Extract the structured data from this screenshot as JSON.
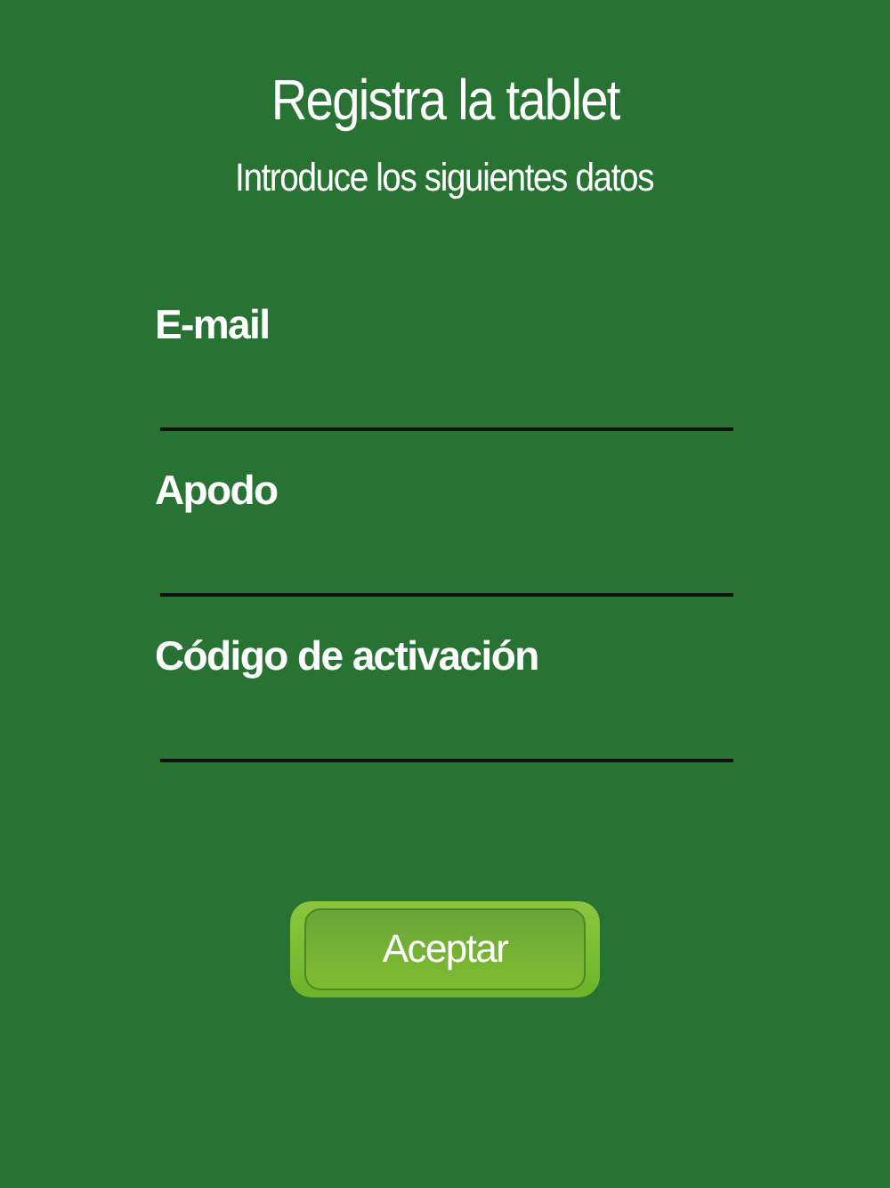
{
  "title": "Registra la tablet",
  "subtitle": "Introduce los siguientes datos",
  "fields": [
    {
      "label": "E-mail"
    },
    {
      "label": "Apodo"
    },
    {
      "label": "Código de activación"
    }
  ],
  "button": {
    "label": "Aceptar"
  }
}
